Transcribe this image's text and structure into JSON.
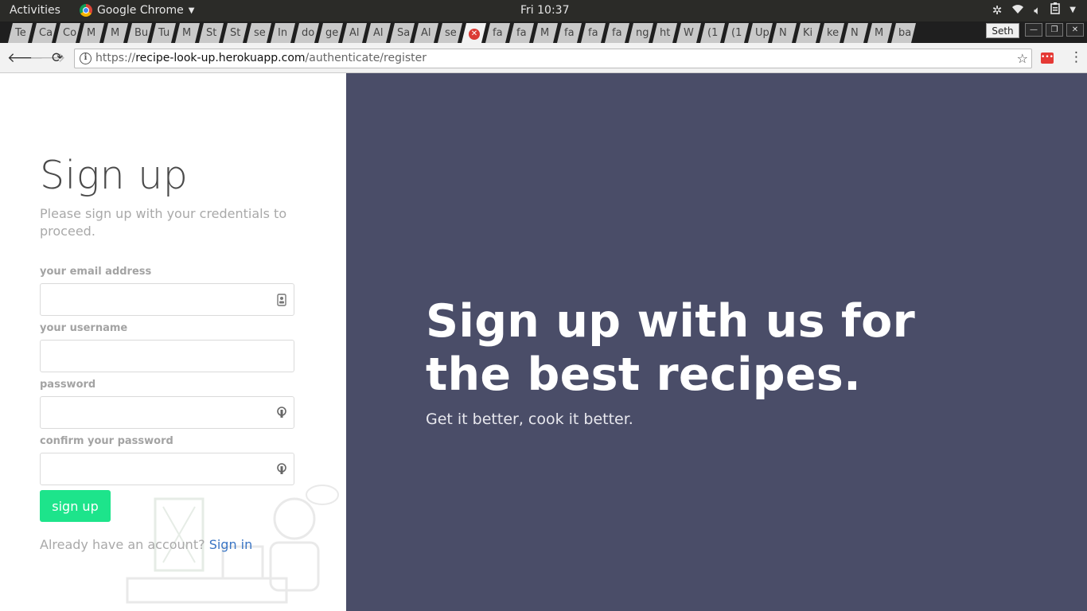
{
  "system_bar": {
    "activities": "Activities",
    "app_name": "Google Chrome",
    "clock": "Fri 10:37"
  },
  "browser": {
    "tabs": [
      "Te",
      "Ca",
      "Co",
      "M",
      "M",
      "Bu",
      "Tu",
      "M",
      "St",
      "St",
      "se",
      "In",
      "do",
      "ge",
      "Al",
      "Al",
      "Sa",
      "Al",
      "se",
      "",
      "fa",
      "fa",
      "M",
      "fa",
      "fa",
      "fa",
      "ng",
      "ht",
      "W",
      "(1",
      "(1",
      "Up",
      "N",
      "Ki",
      "ke",
      "N",
      "M",
      "ba"
    ],
    "active_tab_index": 19,
    "profile_name": "Seth",
    "url_scheme": "https://",
    "url_host": "recipe-look-up.herokuapp.com",
    "url_path": "/authenticate/register"
  },
  "form": {
    "title": "Sign up",
    "subtitle": "Please sign up with your credentials to proceed.",
    "email_label": "your email address",
    "username_label": "your username",
    "password_label": "password",
    "confirm_label": "confirm your password",
    "email_value": "",
    "username_value": "",
    "password_value": "",
    "confirm_value": "",
    "submit_label": "sign up",
    "signin_prompt": "Already have an account?",
    "signin_link": "Sign in"
  },
  "hero": {
    "line1": "Sign up with us for",
    "line2": "the best recipes.",
    "tagline": "Get it better, cook it better."
  },
  "colors": {
    "accent_green": "#1de48b",
    "hero_bg": "#4a4d68",
    "link_blue": "#3a75c4"
  }
}
